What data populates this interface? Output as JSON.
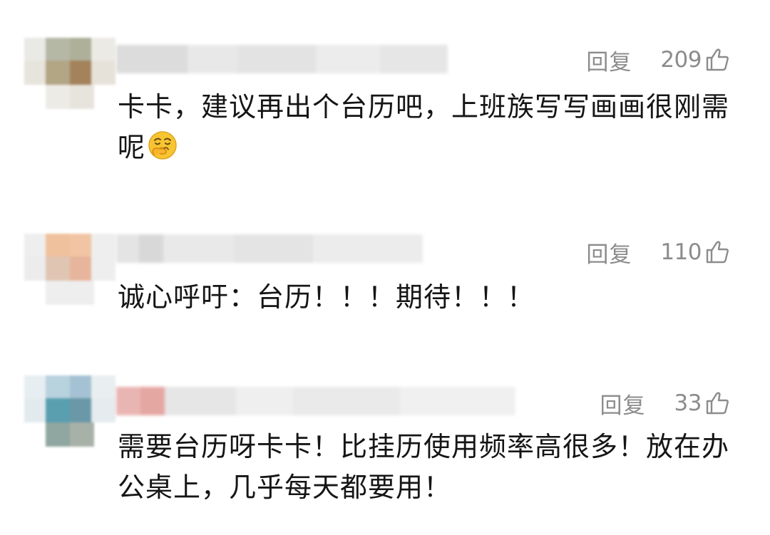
{
  "comments": [
    {
      "reply_label": "回复",
      "like_count": "209",
      "text": "卡卡，建议再出个台历吧，上班族写写画画很刚需呢",
      "emoji": "smiling-face-with-hand-emoji"
    },
    {
      "reply_label": "回复",
      "like_count": "110",
      "text": "诚心呼吁：台历！！！期待！！！"
    },
    {
      "reply_label": "回复",
      "like_count": "33",
      "text": "需要台历呀卡卡！比挂历使用频率高很多！放在办公桌上，几乎每天都要用！"
    }
  ],
  "icons": {
    "like": "thumbs-up-outline-icon",
    "emoji": "smiling-face-with-hand-emoji"
  },
  "colors": {
    "text": "#151515",
    "meta": "#8c8c8c",
    "background": "#ffffff"
  }
}
